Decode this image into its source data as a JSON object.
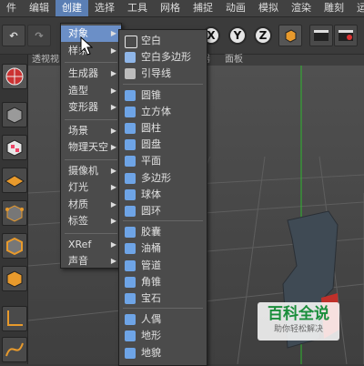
{
  "menubar": {
    "items": [
      "件",
      "编辑",
      "创建",
      "选择",
      "工具",
      "网格",
      "捕捉",
      "动画",
      "模拟",
      "渲染",
      "雕刻",
      "运"
    ],
    "active_index": 2
  },
  "toolbar": {
    "axes": [
      "X",
      "Y",
      "Z"
    ]
  },
  "viewport": {
    "tab_left": "透视视",
    "tab_mid": "器",
    "tab_right": "面板"
  },
  "menu_primary": {
    "items": [
      {
        "label": "对象",
        "submenu": true,
        "highlighted": true
      },
      {
        "label": "样条",
        "submenu": true
      },
      {
        "sep": true
      },
      {
        "label": "生成器",
        "submenu": true
      },
      {
        "label": "造型",
        "submenu": true
      },
      {
        "label": "变形器",
        "submenu": true
      },
      {
        "sep": true
      },
      {
        "label": "场景",
        "submenu": true
      },
      {
        "label": "物理天空",
        "submenu": true
      },
      {
        "sep": true
      },
      {
        "label": "摄像机",
        "submenu": true
      },
      {
        "label": "灯光",
        "submenu": true
      },
      {
        "label": "材质",
        "submenu": true
      },
      {
        "label": "标签",
        "submenu": true
      },
      {
        "sep": true
      },
      {
        "label": "XRef",
        "submenu": true
      },
      {
        "label": "声音",
        "submenu": true
      }
    ]
  },
  "menu_object": {
    "items": [
      {
        "label": "空白",
        "icon": "null-object-icon",
        "color": "#e8e8e8"
      },
      {
        "label": "空白多边形",
        "icon": "empty-polygon-icon",
        "color": "#8fb6e8"
      },
      {
        "label": "引导线",
        "icon": "guide-line-icon",
        "color": "#bdbdbd"
      },
      {
        "sep": true
      },
      {
        "label": "圆锥",
        "icon": "cone-icon",
        "color": "#6ea4e6"
      },
      {
        "label": "立方体",
        "icon": "cube-icon",
        "color": "#6ea4e6"
      },
      {
        "label": "圆柱",
        "icon": "cylinder-icon",
        "color": "#6ea4e6"
      },
      {
        "label": "圆盘",
        "icon": "disc-icon",
        "color": "#6ea4e6"
      },
      {
        "label": "平面",
        "icon": "plane-icon",
        "color": "#6ea4e6"
      },
      {
        "label": "多边形",
        "icon": "polygon-icon",
        "color": "#6ea4e6"
      },
      {
        "label": "球体",
        "icon": "sphere-icon",
        "color": "#6ea4e6"
      },
      {
        "label": "圆环",
        "icon": "torus-icon",
        "color": "#6ea4e6"
      },
      {
        "sep": true
      },
      {
        "label": "胶囊",
        "icon": "capsule-icon",
        "color": "#6ea4e6"
      },
      {
        "label": "油桶",
        "icon": "oil-tank-icon",
        "color": "#6ea4e6"
      },
      {
        "label": "管道",
        "icon": "tube-icon",
        "color": "#6ea4e6"
      },
      {
        "label": "角锥",
        "icon": "pyramid-icon",
        "color": "#6ea4e6"
      },
      {
        "label": "宝石",
        "icon": "gem-icon",
        "color": "#6ea4e6"
      },
      {
        "sep": true
      },
      {
        "label": "人偶",
        "icon": "figure-icon",
        "color": "#6ea4e6"
      },
      {
        "label": "地形",
        "icon": "landscape-icon",
        "color": "#6ea4e6"
      },
      {
        "label": "地貌",
        "icon": "relief-icon",
        "color": "#6ea4e6"
      }
    ]
  },
  "watermark": {
    "title": "百科全说",
    "subtitle": "助你轻松解决"
  },
  "colors": {
    "menu_highlight": "#6b8fc7",
    "menubar_active": "#5b7fb4",
    "icon_blue": "#6ea4e6"
  }
}
